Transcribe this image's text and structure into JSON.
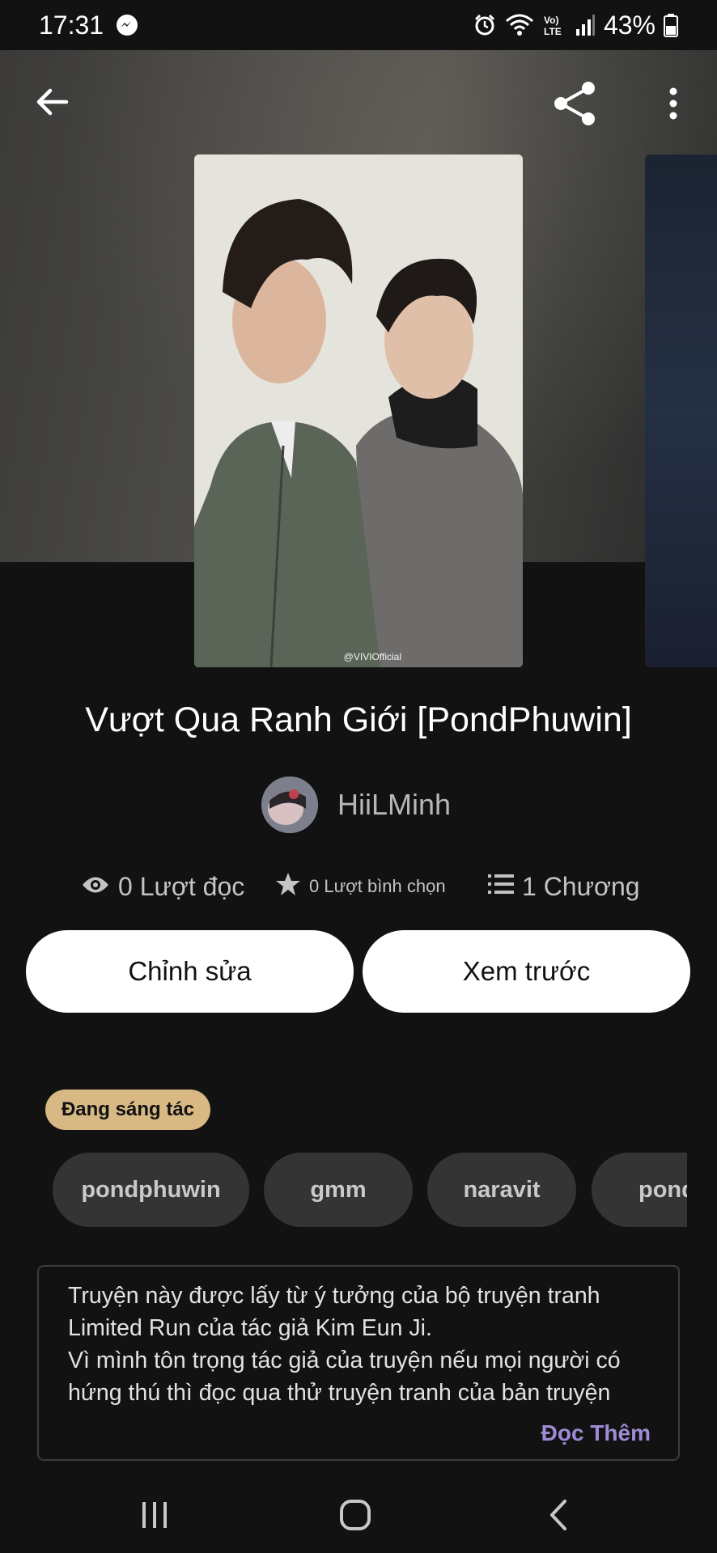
{
  "status_bar": {
    "time": "17:31",
    "battery": "43%",
    "network": "LTE",
    "icons": [
      "messenger-icon",
      "alarm-icon",
      "wifi-icon",
      "volte-icon",
      "signal-icon",
      "battery-icon"
    ]
  },
  "appbar": {
    "icons": [
      "back-arrow-icon",
      "share-icon",
      "more-vert-icon"
    ]
  },
  "cover": {
    "watermark": "@VIVIOfficial"
  },
  "story": {
    "title": "Vượt Qua Ranh Giới [PondPhuwin]",
    "author": "HiiLMinh",
    "stats": {
      "reads": "0 Lượt đọc",
      "votes": "0 Lượt bình chọn",
      "chapters": "1 Chương"
    }
  },
  "actions": {
    "edit_label": "Chỉnh sửa",
    "preview_label": "Xem trước"
  },
  "status_badge": "Đang sáng tác",
  "tags": [
    "pondphuwin",
    "gmm",
    "naravit",
    "pond"
  ],
  "description": {
    "lines": [
      "Truyện này được lấy từ ý tưởng của bộ truyện tranh",
      "Limited Run của tác giả Kim Eun Ji.",
      "Vì mình tôn trọng tác giả của truyện nếu mọi người có",
      "hứng thú thì đọc qua thử truyện tranh của bản truyện"
    ],
    "read_more": "Đọc Thêm"
  },
  "colors": {
    "background": "#121212",
    "badge": "#d9b983",
    "read_more": "#9e8bd6",
    "tag_bg": "#343434"
  },
  "navbar": {
    "icons": [
      "recent-apps-icon",
      "home-icon",
      "back-nav-icon"
    ]
  }
}
